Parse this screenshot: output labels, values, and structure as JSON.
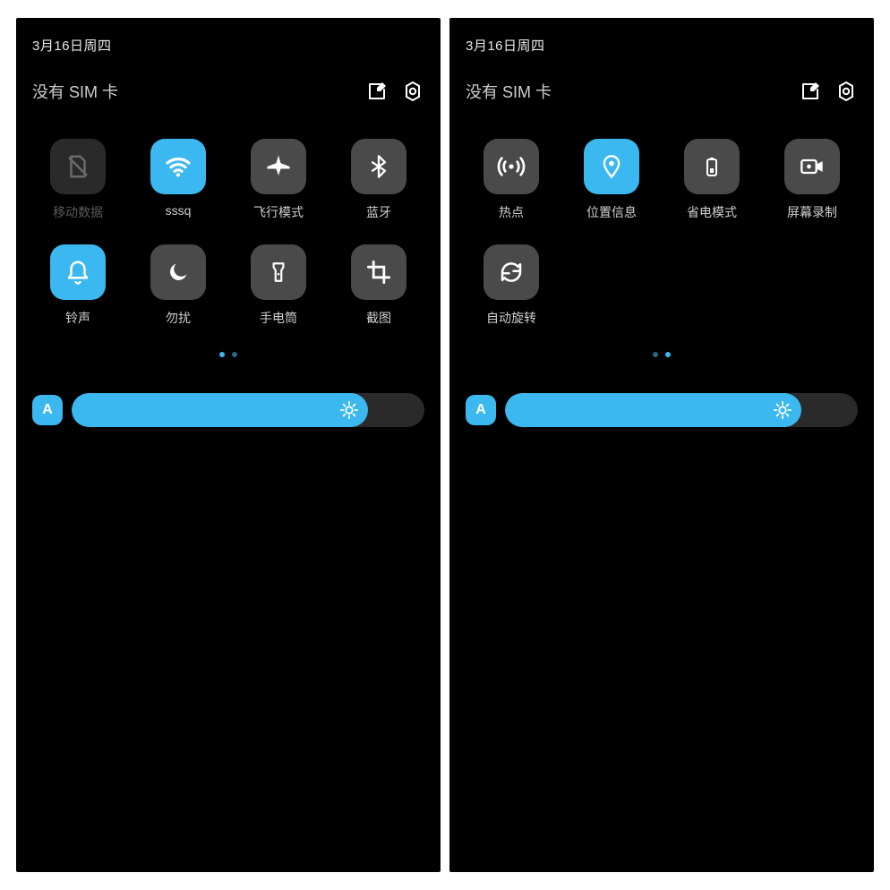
{
  "colors": {
    "accent": "#3bb8ef",
    "tile": "#4a4a4a",
    "disabled": "#2a2a2a"
  },
  "panels": [
    {
      "date": "3月16日周四",
      "sim_status": "没有 SIM 卡",
      "tiles": [
        {
          "icon": "sim-off-icon",
          "label": "移动数据",
          "state": "disabled",
          "dim": true
        },
        {
          "icon": "wifi-icon",
          "label": "sssq",
          "state": "active"
        },
        {
          "icon": "airplane-icon",
          "label": "飞行模式",
          "state": "off"
        },
        {
          "icon": "bluetooth-icon",
          "label": "蓝牙",
          "state": "off"
        },
        {
          "icon": "bell-icon",
          "label": "铃声",
          "state": "active"
        },
        {
          "icon": "moon-icon",
          "label": "勿扰",
          "state": "off"
        },
        {
          "icon": "flashlight-icon",
          "label": "手电筒",
          "state": "off"
        },
        {
          "icon": "crop-icon",
          "label": "截图",
          "state": "off"
        }
      ],
      "page_index": 0,
      "page_count": 2,
      "brightness": {
        "auto_label": "A",
        "level_percent": 84
      }
    },
    {
      "date": "3月16日周四",
      "sim_status": "没有 SIM 卡",
      "tiles": [
        {
          "icon": "hotspot-icon",
          "label": "热点",
          "state": "off"
        },
        {
          "icon": "location-icon",
          "label": "位置信息",
          "state": "active"
        },
        {
          "icon": "battery-icon",
          "label": "省电模式",
          "state": "off"
        },
        {
          "icon": "record-icon",
          "label": "屏幕录制",
          "state": "off"
        },
        {
          "icon": "rotate-icon",
          "label": "自动旋转",
          "state": "off"
        }
      ],
      "page_index": 1,
      "page_count": 2,
      "brightness": {
        "auto_label": "A",
        "level_percent": 84
      }
    }
  ]
}
